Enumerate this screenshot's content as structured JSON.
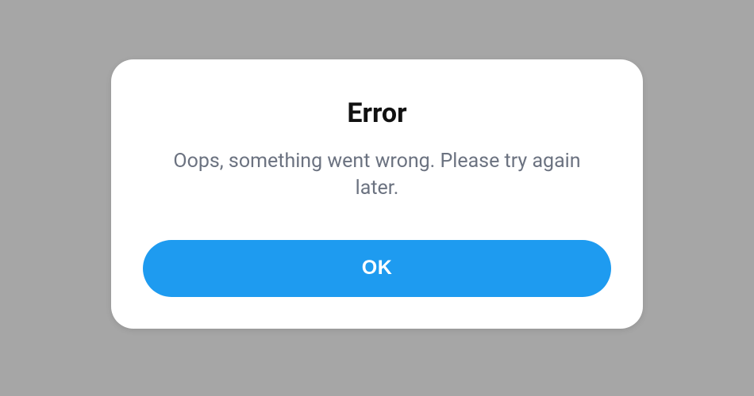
{
  "dialog": {
    "title": "Error",
    "message": "Oops, something went wrong. Please try again later.",
    "ok_label": "OK"
  },
  "colors": {
    "background": "#a6a6a6",
    "dialog_bg": "#ffffff",
    "title_text": "#111111",
    "message_text": "#6b7280",
    "button_bg": "#1e9bf0",
    "button_text": "#ffffff"
  }
}
